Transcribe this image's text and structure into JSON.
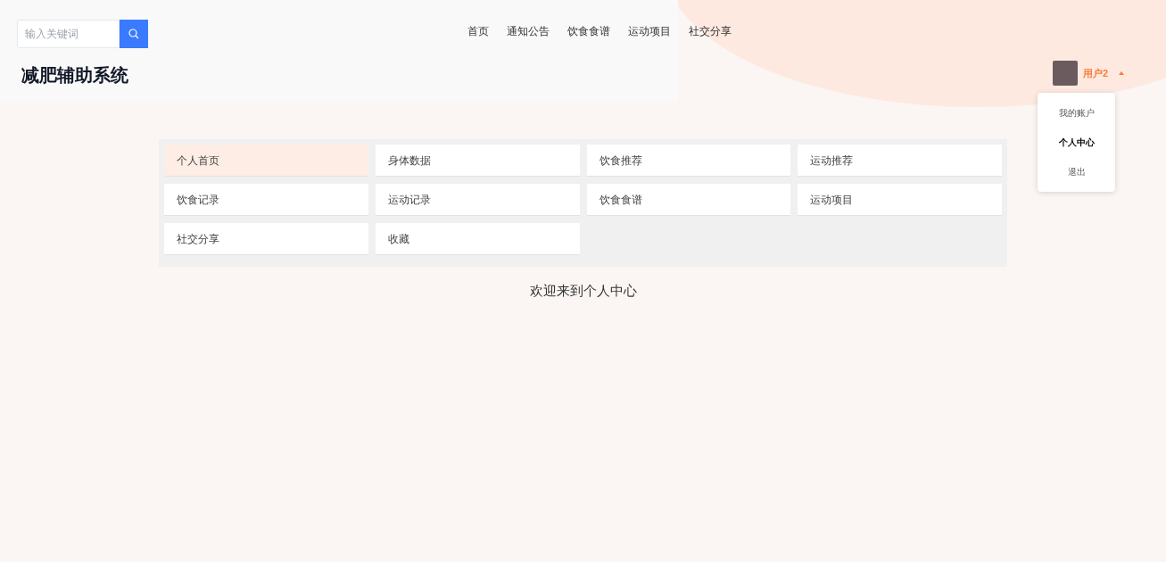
{
  "search": {
    "placeholder": "输入关键词"
  },
  "nav": [
    {
      "label": "首页"
    },
    {
      "label": "通知公告"
    },
    {
      "label": "饮食食谱"
    },
    {
      "label": "运动项目"
    },
    {
      "label": "社交分享"
    }
  ],
  "site_title": "减肥辅助系统",
  "user": {
    "name": "用户2",
    "menu_open": true,
    "menu": [
      {
        "label": "我的账户",
        "selected": false
      },
      {
        "label": "个人中心",
        "selected": true
      },
      {
        "label": "退出",
        "selected": false
      }
    ]
  },
  "center_menu": [
    {
      "label": "个人首页",
      "selected": true
    },
    {
      "label": "身体数据",
      "selected": false
    },
    {
      "label": "饮食推荐",
      "selected": false
    },
    {
      "label": "运动推荐",
      "selected": false
    },
    {
      "label": "饮食记录",
      "selected": false
    },
    {
      "label": "运动记录",
      "selected": false
    },
    {
      "label": "饮食食谱",
      "selected": false
    },
    {
      "label": "运动项目",
      "selected": false
    },
    {
      "label": "社交分享",
      "selected": false
    },
    {
      "label": "收藏",
      "selected": false
    }
  ],
  "welcome": "欢迎来到个人中心"
}
